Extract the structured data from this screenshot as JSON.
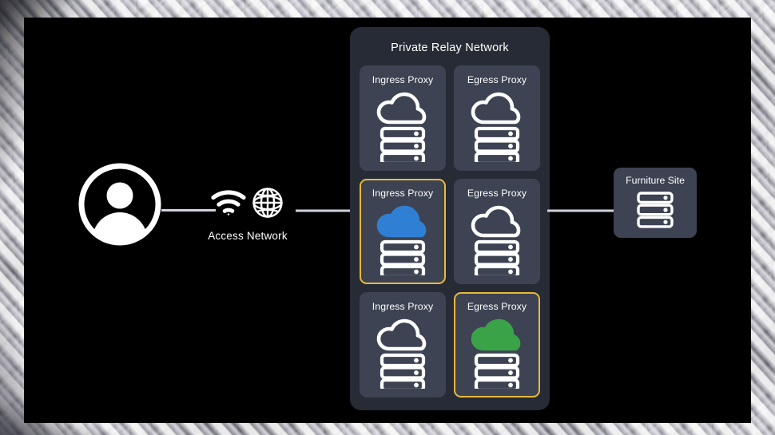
{
  "diagram": {
    "title": "Private Relay Network",
    "client": {
      "icon": "user-avatar-icon"
    },
    "access_network": {
      "label": "Access Network",
      "icons": [
        "wifi-icon",
        "globe-icon"
      ]
    },
    "relay_panel": {
      "title": "Private Relay Network",
      "cards": [
        {
          "label": "Ingress Proxy",
          "cloud_state": "outline",
          "highlighted": false
        },
        {
          "label": "Egress Proxy",
          "cloud_state": "outline",
          "highlighted": false
        },
        {
          "label": "Ingress Proxy",
          "cloud_state": "filled",
          "highlighted": true
        },
        {
          "label": "Egress Proxy",
          "cloud_state": "outline",
          "highlighted": false
        },
        {
          "label": "Ingress Proxy",
          "cloud_state": "outline",
          "highlighted": false
        },
        {
          "label": "Egress Proxy",
          "cloud_state": "filled",
          "highlighted": true
        }
      ]
    },
    "destination": {
      "label": "Furniture Site",
      "icon": "server-stack-icon"
    },
    "connectors": [
      {
        "from": "client",
        "to": "access-network",
        "style": "line"
      },
      {
        "from": "access-network",
        "to": "relay-panel",
        "style": "arrow"
      },
      {
        "from": "relay-panel",
        "to": "destination",
        "style": "arrow"
      }
    ]
  },
  "colors": {
    "canvas": "#000000",
    "panel": "#262b35",
    "card": "#3d4352",
    "highlight_border": "#e8b93c",
    "cloud_blue": "#2f7fd4",
    "cloud_green": "#3aa348",
    "stroke_white": "#ffffff",
    "connector": "#cdd2dc"
  }
}
